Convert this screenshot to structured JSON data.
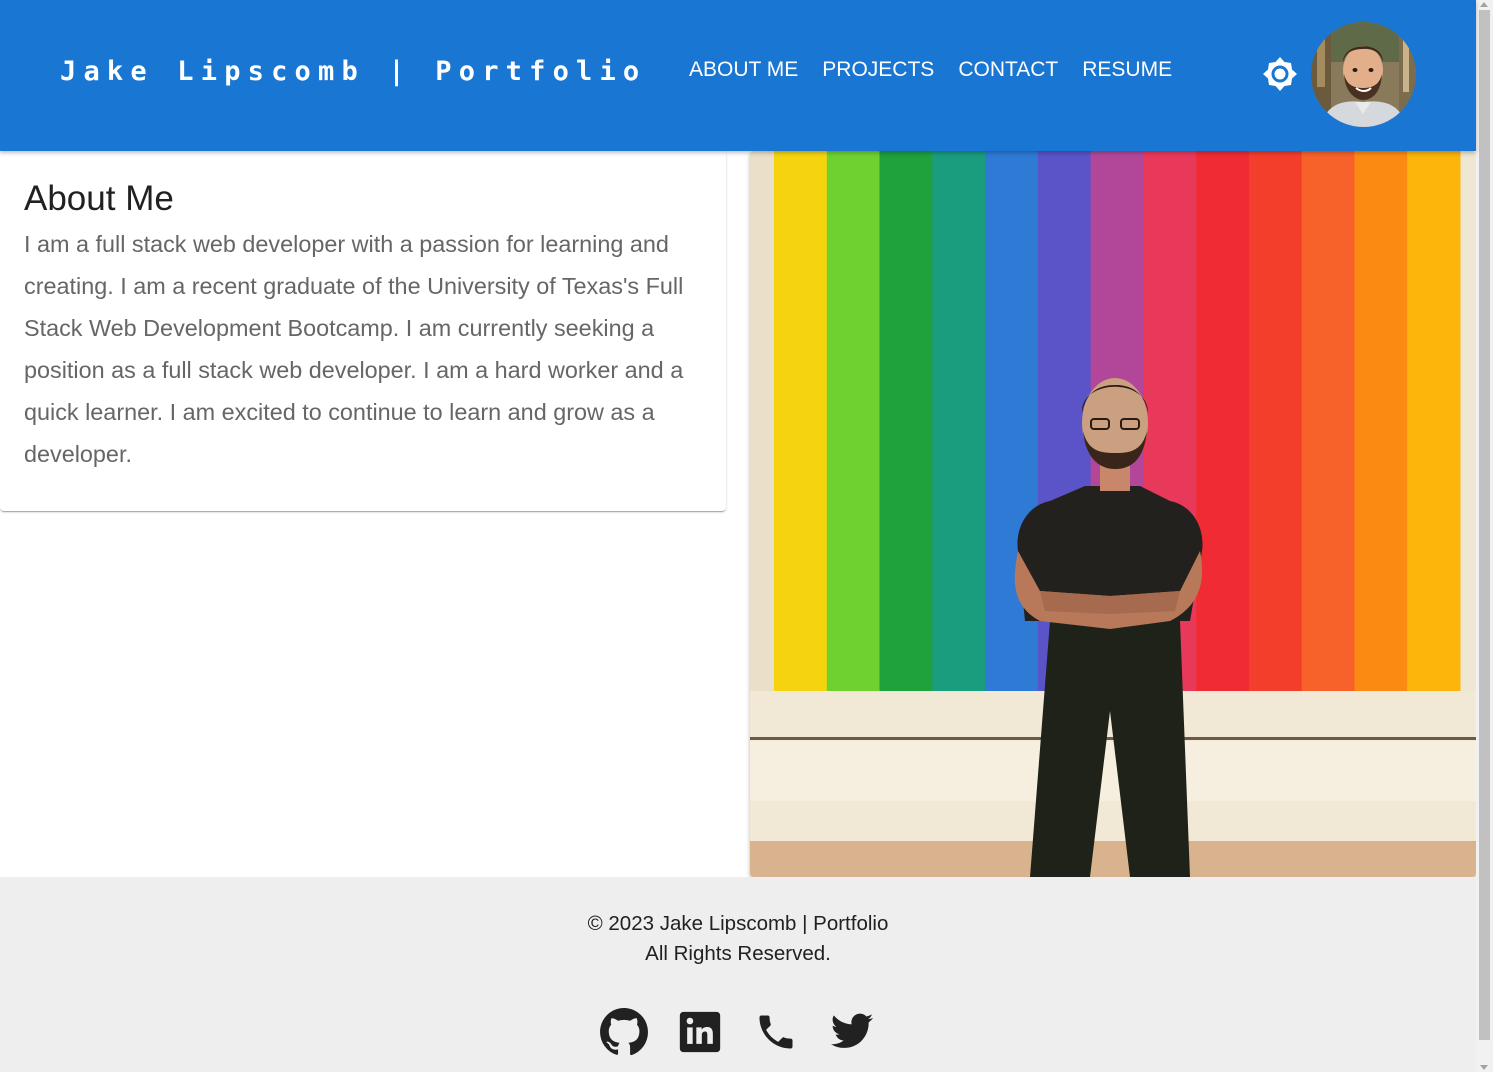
{
  "header": {
    "brand": "Jake Lipscomb | Portfolio",
    "nav": [
      "ABOUT ME",
      "PROJECTS",
      "CONTACT",
      "RESUME"
    ],
    "theme_icon": "sun-icon",
    "avatar_alt": "profile photo",
    "bg_color": "#1976d2"
  },
  "about": {
    "title": "About Me",
    "text": "I am a full stack web developer with a passion for learning and creating. I am a recent graduate of the University of Texas's Full Stack Web Development Bootcamp. I am currently seeking a position as a full stack web developer. I am a hard worker and a quick learner. I am excited to continue to learn and grow as a developer."
  },
  "photo": {
    "stripe_colors": [
      "#f5d40f",
      "#6fd130",
      "#1fa13c",
      "#1a9c7e",
      "#2f7ad4",
      "#5a54c8",
      "#b2479a",
      "#e8395a",
      "#f02b33",
      "#f23e2a",
      "#f7622a",
      "#fb8a12",
      "#fcb50b"
    ]
  },
  "footer": {
    "copyright": "© 2023 Jake Lipscomb | Portfolio",
    "rights": "All Rights Reserved.",
    "social": [
      "github-icon",
      "linkedin-icon",
      "phone-icon",
      "twitter-icon"
    ]
  }
}
